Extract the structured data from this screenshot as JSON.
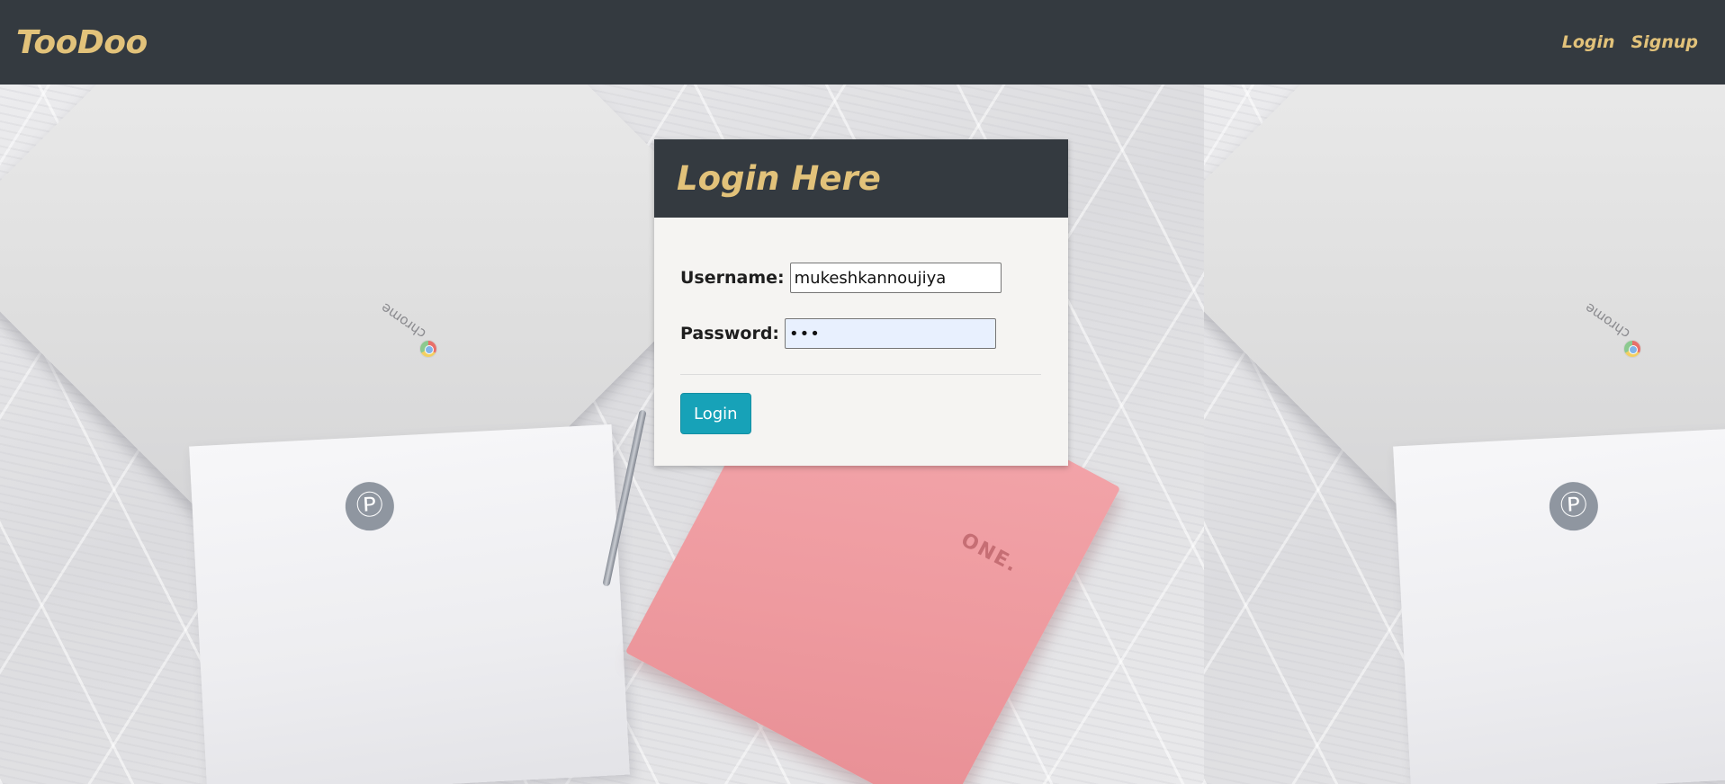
{
  "navbar": {
    "brand": "TooDoo",
    "links": [
      {
        "label": "Login"
      },
      {
        "label": "Signup"
      }
    ]
  },
  "login_card": {
    "title": "Login Here",
    "username": {
      "label": "Username:",
      "value": "mukeshkannoujiya"
    },
    "password": {
      "label": "Password:",
      "value": "•••"
    },
    "submit_label": "Login"
  },
  "background": {
    "chrome_text": "chrome",
    "bag_logo": "Ⓟ",
    "notebook_text": "ONE."
  },
  "colors": {
    "navbar_bg": "#343a40",
    "accent_gold": "#e2c27a",
    "button_bg": "#17a2b8",
    "card_bg": "#f5f4f2"
  }
}
